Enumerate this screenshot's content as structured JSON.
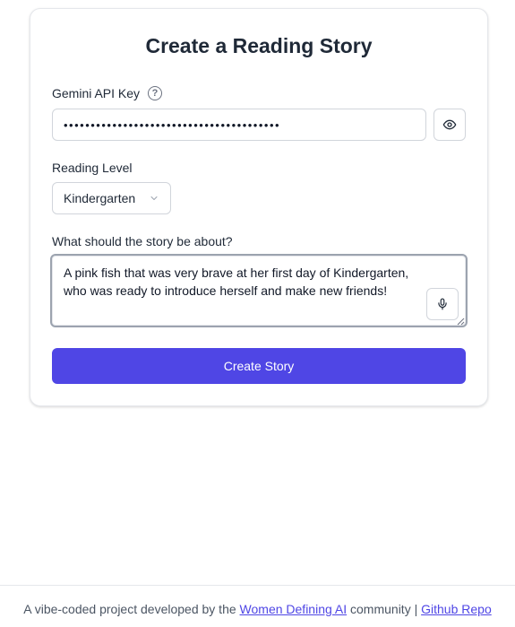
{
  "form": {
    "title": "Create a Reading Story",
    "api_key_label": "Gemini API Key",
    "api_key_value": "••••••••••••••••••••••••••••••••••••••••",
    "reading_level_label": "Reading Level",
    "reading_level_value": "Kindergarten",
    "story_label": "What should the story be about?",
    "story_value": "A pink fish that was very brave at her first day of Kindergarten, who was ready to introduce herself and make new friends!",
    "submit_label": "Create Story"
  },
  "icons": {
    "help": "question-circle-icon",
    "toggle_visibility": "eye-icon",
    "dropdown": "chevron-down-icon",
    "voice_input": "microphone-icon"
  },
  "footer": {
    "prefix": "A vibe-coded project developed by the",
    "community_link": "Women Defining AI",
    "middle": "community |",
    "repo_link": "Github Repo"
  },
  "colors": {
    "accent": "#4f46e5",
    "border": "#d1d5db",
    "text": "#1f2937"
  }
}
